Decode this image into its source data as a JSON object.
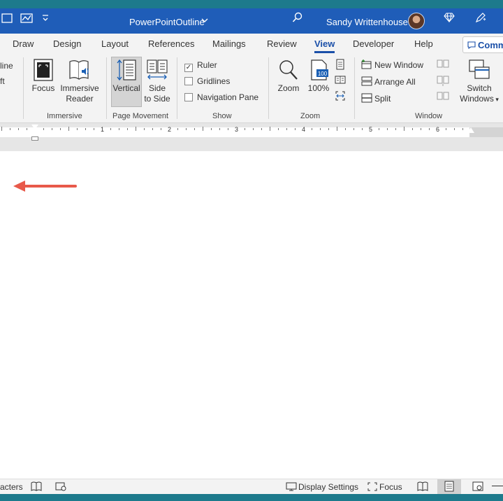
{
  "window": {
    "doc_title": "PowerPointOutline",
    "user_name": "Sandy Writtenhouse"
  },
  "tabs": [
    "Draw",
    "Design",
    "Layout",
    "References",
    "Mailings",
    "Review",
    "View",
    "Developer",
    "Help"
  ],
  "active_tab": "View",
  "comments_label": "Comm",
  "ribbon": {
    "views_partial": [
      "line",
      "ft"
    ],
    "immersive": {
      "label": "Immersive",
      "focus": "Focus",
      "reader_line1": "Immersive",
      "reader_line2": "Reader"
    },
    "page_movement": {
      "label": "Page Movement",
      "vertical": "Vertical",
      "side_line1": "Side",
      "side_line2": "to Side"
    },
    "show": {
      "label": "Show",
      "ruler": "Ruler",
      "gridlines": "Gridlines",
      "nav_pane": "Navigation Pane",
      "ruler_checked": true,
      "gridlines_checked": false,
      "nav_checked": false
    },
    "zoom": {
      "label": "Zoom",
      "zoom": "Zoom",
      "percent": "100%",
      "badge": "100"
    },
    "window": {
      "label": "Window",
      "new_window": "New Window",
      "arrange_all": "Arrange All",
      "split": "Split",
      "switch_line1": "Switch",
      "switch_line2": "Windows"
    }
  },
  "ruler_numbers": [
    "1",
    "2",
    "3",
    "4",
    "5",
    "6"
  ],
  "status": {
    "characters": "acters",
    "display_settings": "Display Settings",
    "focus": "Focus"
  },
  "colors": {
    "title_blue": "#1f5db8",
    "teal": "#1d7a8c",
    "accent": "#1a4fa8",
    "arrow": "#e8594a"
  }
}
